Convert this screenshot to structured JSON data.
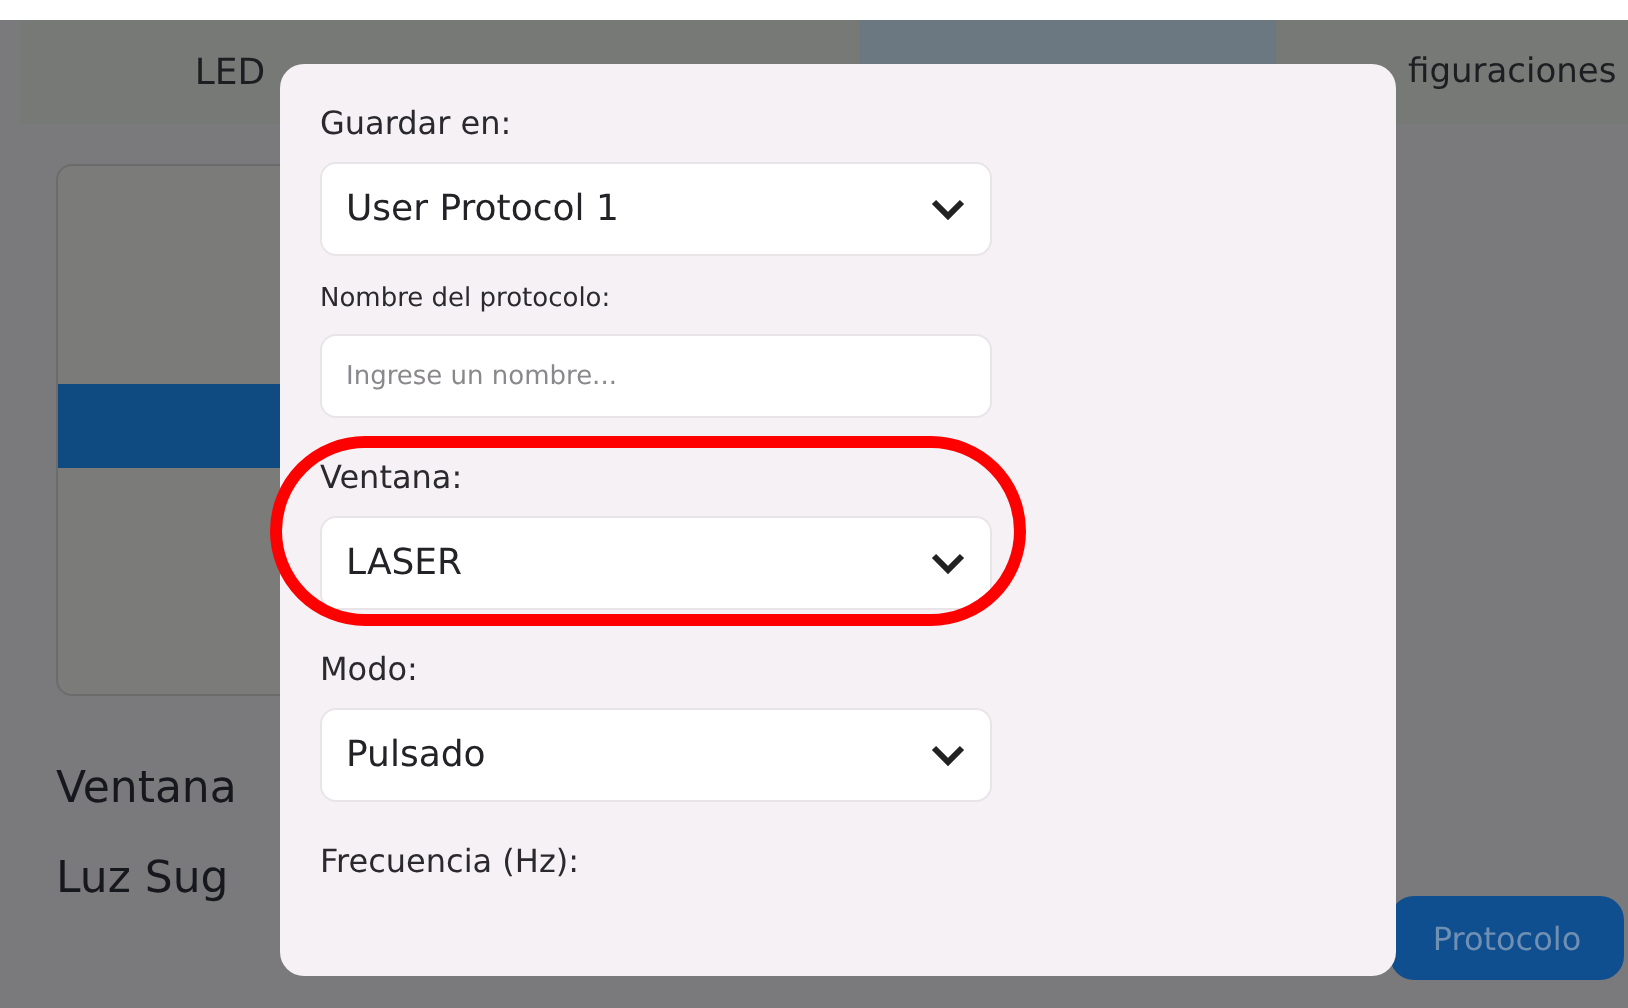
{
  "tabs": [
    {
      "label": "LED",
      "selected": false
    },
    {
      "selected": false
    },
    {
      "selected": true
    },
    {
      "label": "figuraciones",
      "selected": false
    }
  ],
  "background": {
    "lines": [
      "Ventana",
      "Luz Sug"
    ],
    "button": "Protocolo"
  },
  "dialog": {
    "fields": [
      {
        "kind": "select",
        "label": "Guardar en:",
        "value": "User Protocol 1"
      },
      {
        "kind": "text",
        "label": "Nombre del protocolo:",
        "placeholder": "Ingrese un nombre..."
      },
      {
        "kind": "select",
        "label": "Ventana:",
        "value": "LASER",
        "highlighted": true
      },
      {
        "kind": "select",
        "label": "Modo:",
        "value": "Pulsado"
      },
      {
        "kind": "heading",
        "label": "Frecuencia (Hz):"
      }
    ]
  }
}
